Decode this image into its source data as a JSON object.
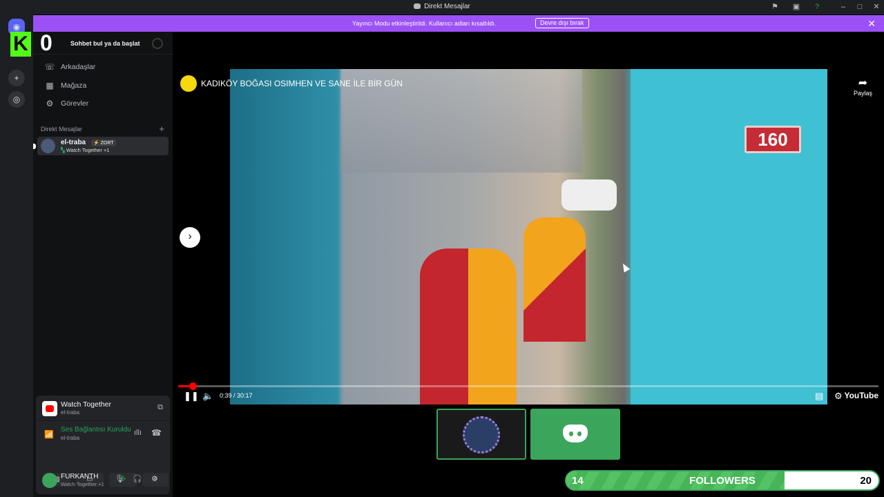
{
  "window": {
    "title": "Direkt Mesajlar",
    "icons": [
      "inbox-flag-icon",
      "screen-icon",
      "help-icon",
      "minimize-icon",
      "maximize-icon",
      "close-icon"
    ]
  },
  "banner": {
    "message": "Yayıncı Modu etkinleştirildi. Kullanıcı adları kısaltıldı.",
    "button_label": "Devre dışı bırak",
    "color": "#9b51f5"
  },
  "sidebar": {
    "search_placeholder": "Sohbet bul ya da başlat",
    "nav_items": [
      {
        "label": "Arkadaşlar",
        "icon": "friends-icon"
      },
      {
        "label": "Mağaza",
        "icon": "shop-icon"
      },
      {
        "label": "Görevler",
        "icon": "quests-icon"
      }
    ],
    "dm_header": "Direkt Mesajlar",
    "dm": {
      "name": "el-traba",
      "tag": "⚡ ZORT",
      "status": "Watch Together +1"
    }
  },
  "overlay": {
    "kick_count": "0"
  },
  "activity": {
    "title": "Watch Together",
    "subtitle": "el-traba",
    "voice_status": "Ses Bağlantısı Kuruldu",
    "voice_channel": "el-traba"
  },
  "user": {
    "name": "FURKANTH",
    "status": "Watch Together +1"
  },
  "video": {
    "title": "KADIKÖY BOĞASI OSIMHEN VE SANE İLE BİR GÜN",
    "share_label": "Paylaş",
    "time": "0:39 / 30:17",
    "progress": 0.021,
    "door_number": "160",
    "brand": "YouTube"
  },
  "followers": {
    "current": "14",
    "label": "FOLLOWERS",
    "goal": "20",
    "progress": 0.7
  }
}
